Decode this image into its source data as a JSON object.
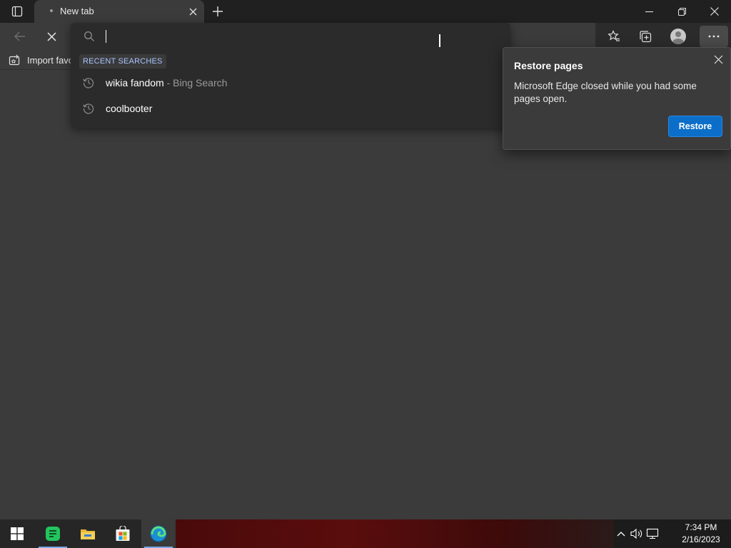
{
  "tab": {
    "title": "New tab"
  },
  "address": {
    "value": "",
    "placeholder": ""
  },
  "favorites": {
    "import_label": "Import favo"
  },
  "dropdown": {
    "section_title": "RECENT SEARCHES",
    "items": [
      {
        "text": "wikia fandom",
        "sub": " - Bing Search"
      },
      {
        "text": "coolbooter",
        "sub": ""
      }
    ]
  },
  "restore_popup": {
    "title": "Restore pages",
    "message": "Microsoft Edge closed while you had some pages open.",
    "button": "Restore"
  },
  "taskbar": {
    "time": "7:34 PM",
    "date": "2/16/2023",
    "apps": [
      "start-icon",
      "notepad-green-icon",
      "file-explorer-icon",
      "microsoft-store-icon",
      "edge-icon"
    ]
  },
  "colors": {
    "accent": "#0b6ec8",
    "section_head": "#a7c4ff",
    "page_bg": "#3b3b3b",
    "dropdown_bg": "#2b2b2b"
  }
}
